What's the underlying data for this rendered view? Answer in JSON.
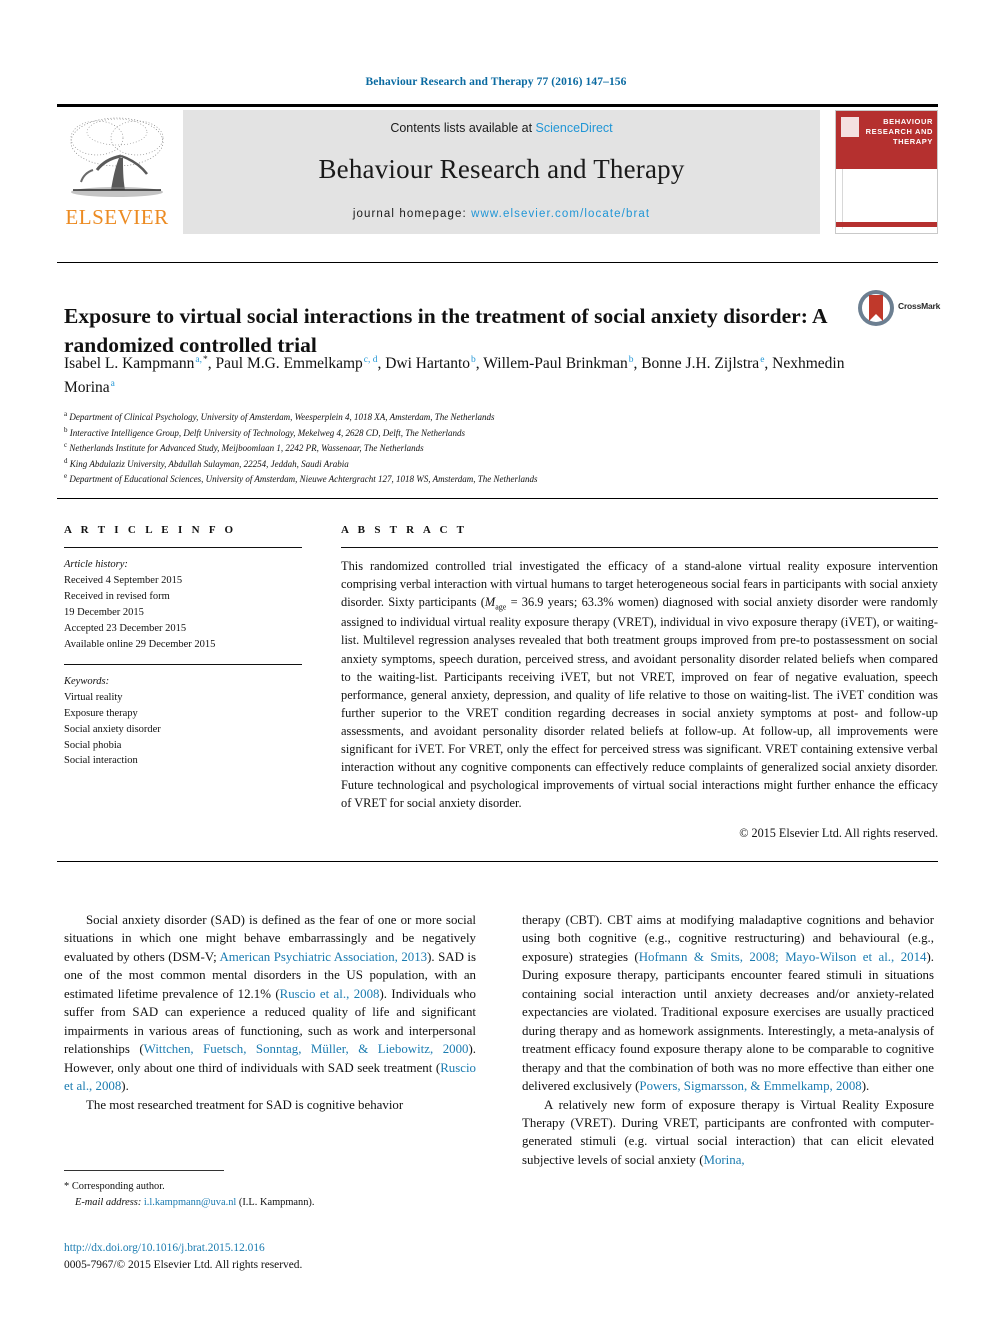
{
  "running_head": "Behaviour Research and Therapy 77 (2016) 147–156",
  "colors": {
    "link_blue": "#1a7bb0",
    "sciencedirect_blue": "#2196d6",
    "elsevier_orange": "#ec8b22",
    "cover_red": "#b5302f"
  },
  "banner": {
    "contents_prefix": "Contents lists available at ",
    "sciencedirect": "ScienceDirect",
    "journal_title": "Behaviour Research and Therapy",
    "homepage_prefix": "journal homepage: ",
    "homepage_url": "www.elsevier.com/locate/brat",
    "publisher": "ELSEVIER",
    "cover_title": "BEHAVIOUR RESEARCH AND THERAPY"
  },
  "article": {
    "title": "Exposure to virtual social interactions in the treatment of social anxiety disorder: A randomized controlled trial",
    "crossmark_label": "CrossMark",
    "authors": [
      {
        "name": "Isabel L. Kampmann",
        "marks": "a,",
        "star": true
      },
      {
        "name": "Paul M.G. Emmelkamp",
        "marks": "c, d",
        "star": false
      },
      {
        "name": "Dwi Hartanto",
        "marks": "b",
        "star": false
      },
      {
        "name": "Willem-Paul Brinkman",
        "marks": "b",
        "star": false
      },
      {
        "name": "Bonne J.H. Zijlstra",
        "marks": "e",
        "star": false
      },
      {
        "name": "Nexhmedin Morina",
        "marks": "a",
        "star": false
      }
    ],
    "affiliations": [
      {
        "mark": "a",
        "text": "Department of Clinical Psychology, University of Amsterdam, Weesperplein 4, 1018 XA, Amsterdam, The Netherlands"
      },
      {
        "mark": "b",
        "text": "Interactive Intelligence Group, Delft University of Technology, Mekelweg 4, 2628 CD, Delft, The Netherlands"
      },
      {
        "mark": "c",
        "text": "Netherlands Institute for Advanced Study, Meijboomlaan 1, 2242 PR, Wassenaar, The Netherlands"
      },
      {
        "mark": "d",
        "text": "King Abdulaziz University, Abdullah Sulayman, 22254, Jeddah, Saudi Arabia"
      },
      {
        "mark": "e",
        "text": "Department of Educational Sciences, University of Amsterdam, Nieuwe Achtergracht 127, 1018 WS, Amsterdam, The Netherlands"
      }
    ]
  },
  "article_info": {
    "heading": "A R T I C L E   I N F O",
    "history_label": "Article history:",
    "history": [
      "Received 4 September 2015",
      "Received in revised form",
      "19 December 2015",
      "Accepted 23 December 2015",
      "Available online 29 December 2015"
    ],
    "keywords_label": "Keywords:",
    "keywords": [
      "Virtual reality",
      "Exposure therapy",
      "Social anxiety disorder",
      "Social phobia",
      "Social interaction"
    ]
  },
  "abstract": {
    "heading": "A B S T R A C T",
    "text": "This randomized controlled trial investigated the efficacy of a stand-alone virtual reality exposure intervention comprising verbal interaction with virtual humans to target heterogeneous social fears in participants with social anxiety disorder. Sixty participants (Mage = 36.9 years; 63.3% women) diagnosed with social anxiety disorder were randomly assigned to individual virtual reality exposure therapy (VRET), individual in vivo exposure therapy (iVET), or waiting-list. Multilevel regression analyses revealed that both treatment groups improved from pre-to postassessment on social anxiety symptoms, speech duration, perceived stress, and avoidant personality disorder related beliefs when compared to the waiting-list. Participants receiving iVET, but not VRET, improved on fear of negative evaluation, speech performance, general anxiety, depression, and quality of life relative to those on waiting-list. The iVET condition was further superior to the VRET condition regarding decreases in social anxiety symptoms at post- and follow-up assessments, and avoidant personality disorder related beliefs at follow-up. At follow-up, all improvements were significant for iVET. For VRET, only the effect for perceived stress was significant. VRET containing extensive verbal interaction without any cognitive components can effectively reduce complaints of generalized social anxiety disorder. Future technological and psychological improvements of virtual social interactions might further enhance the efficacy of VRET for social anxiety disorder.",
    "copyright": "© 2015 Elsevier Ltd. All rights reserved."
  },
  "body": {
    "left_paragraphs": [
      "Social anxiety disorder (SAD) is defined as the fear of one or more social situations in which one might behave embarrassingly and be negatively evaluated by others (DSM-V; <span class=\"ref\">American Psychiatric Association, 2013</span>). SAD is one of the most common mental disorders in the US population, with an estimated lifetime prevalence of 12.1% (<span class=\"ref\">Ruscio et al., 2008</span>). Individuals who suffer from SAD can experience a reduced quality of life and significant impairments in various areas of functioning, such as work and interpersonal relationships (<span class=\"ref\">Wittchen, Fuetsch, Sonntag, M&uuml;ller, &amp; Liebowitz, 2000</span>). However, only about one third of individuals with SAD seek treatment (<span class=\"ref\">Ruscio et al., 2008</span>).",
      "The most researched treatment for SAD is cognitive behavior"
    ],
    "right_paragraphs": [
      "therapy (CBT). CBT aims at modifying maladaptive cognitions and behavior using both cognitive (e.g., cognitive restructuring) and behavioural (e.g., exposure) strategies (<span class=\"ref\">Hofmann &amp; Smits, 2008; Mayo-Wilson et al., 2014</span>). During exposure therapy, participants encounter feared stimuli in situations containing social interaction until anxiety decreases and/or anxiety-related expectancies are violated. Traditional exposure exercises are usually practiced during therapy and as homework assignments. Interestingly, a meta-analysis of treatment efficacy found exposure therapy alone to be comparable to cognitive therapy and that the combination of both was no more effective than either one delivered exclusively (<span class=\"ref\">Powers, Sigmarsson, &amp; Emmelkamp, 2008</span>).",
      "A relatively new form of exposure therapy is Virtual Reality Exposure Therapy (VRET). During VRET, participants are confronted with computer-generated stimuli (e.g. virtual social interaction) that can elicit elevated subjective levels of social anxiety (<span class=\"ref\">Morina,</span>"
    ]
  },
  "footnotes": {
    "corresponding": "Corresponding author.",
    "email_label": "E-mail address:",
    "email": "i.l.kampmann@uva.nl",
    "email_owner": "(I.L. Kampmann).",
    "doi": "http://dx.doi.org/10.1016/j.brat.2015.12.016",
    "issn_line": "0005-7967/© 2015 Elsevier Ltd. All rights reserved."
  }
}
